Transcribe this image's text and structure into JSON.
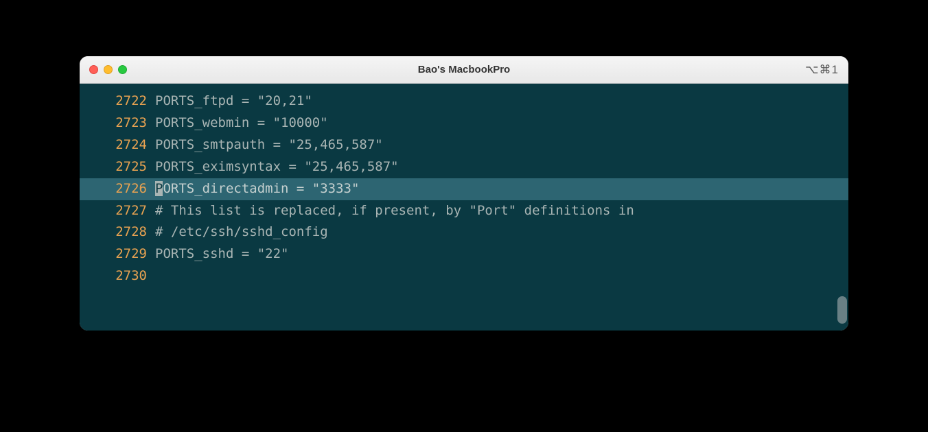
{
  "window": {
    "title": "Bao's MacbookPro",
    "shortcut": "⌥⌘1"
  },
  "editor": {
    "highlighted_index": 4,
    "cursor_char": "P",
    "lines": [
      {
        "number": "2722",
        "text": "PORTS_ftpd = \"20,21\""
      },
      {
        "number": "2723",
        "text": "PORTS_webmin = \"10000\""
      },
      {
        "number": "2724",
        "text": "PORTS_smtpauth = \"25,465,587\""
      },
      {
        "number": "2725",
        "text": "PORTS_eximsyntax = \"25,465,587\""
      },
      {
        "number": "2726",
        "text": "ORTS_directadmin = \"3333\""
      },
      {
        "number": "2727",
        "text": "# This list is replaced, if present, by \"Port\" definitions in"
      },
      {
        "number": "2728",
        "text": "# /etc/ssh/sshd_config"
      },
      {
        "number": "2729",
        "text": "PORTS_sshd = \"22\""
      },
      {
        "number": "2730",
        "text": ""
      }
    ]
  }
}
